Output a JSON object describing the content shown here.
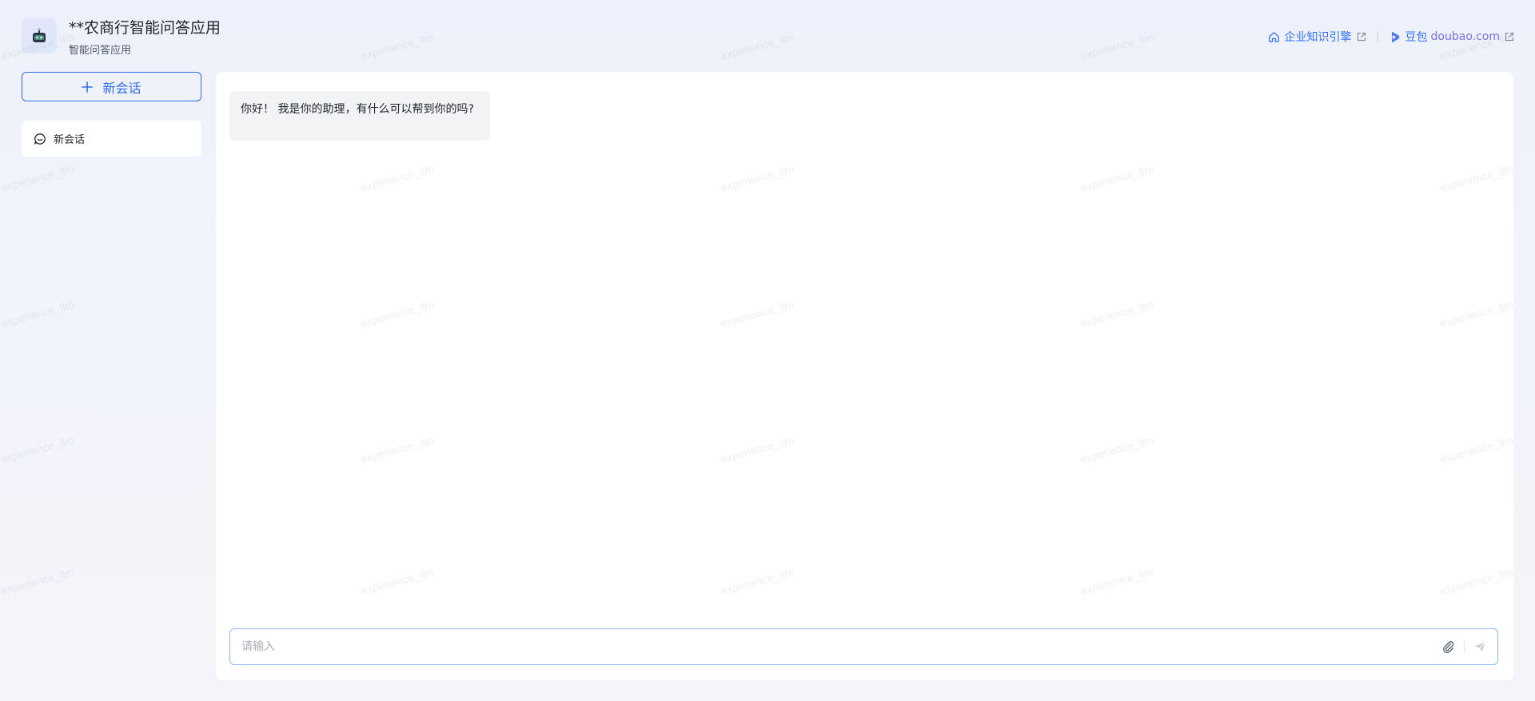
{
  "app": {
    "title": "**农商行智能问答应用",
    "subtitle": "智能问答应用"
  },
  "header_links": [
    {
      "label": "企业知识引擎",
      "icon": "home-icon"
    },
    {
      "label": "豆包",
      "domain": "doubao.com",
      "icon": "doubao-logo-icon"
    }
  ],
  "sidebar": {
    "new_chat_label": "新会话",
    "sessions": [
      {
        "label": "新会话",
        "icon": "chat-bubble-icon"
      }
    ]
  },
  "chat": {
    "messages": [
      {
        "role": "assistant",
        "text": "你好！ 我是你的助理，有什么可以帮到你的吗?"
      }
    ],
    "input_placeholder": "请输入",
    "input_value": ""
  },
  "watermark": "experience_llm",
  "colors": {
    "accent": "#2f6ee6",
    "link": "#3370ff",
    "doubao_domain": "#7b6cf0",
    "input_border": "#8fb8f8",
    "bubble_bg": "#f2f3f5",
    "page_bg": "#f2f4fb"
  }
}
